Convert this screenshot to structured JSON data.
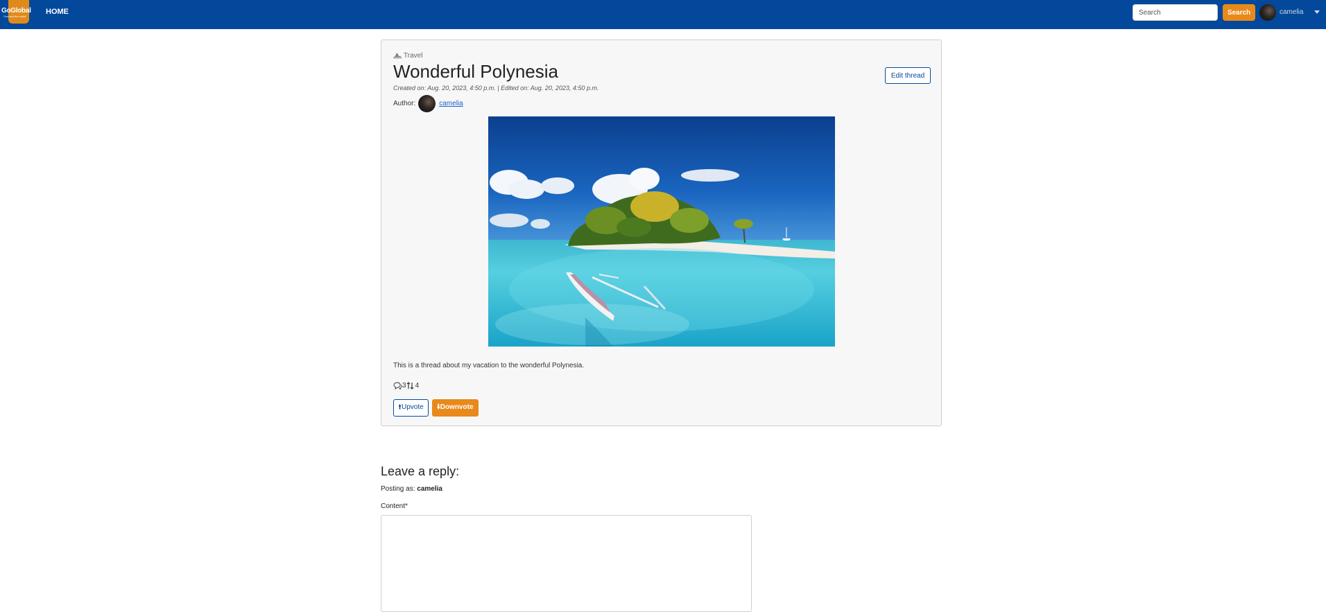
{
  "navbar": {
    "logo_text": "GoGlobal",
    "logo_subtext": "Connect the world",
    "home_label": "HOME",
    "search_placeholder": "Search",
    "search_button": "Search",
    "username": "camelia",
    "brand_color": "#03489a",
    "accent_color": "#e8891a"
  },
  "thread": {
    "category": "Travel",
    "category_icon": "plane-icon",
    "title": "Wonderful Polynesia",
    "meta": "Created on: Aug. 20, 2023, 4:50 p.m. | Edited on: Aug. 20, 2023, 4:50 p.m.",
    "author_label": "Author:",
    "author_name": "camelia",
    "edit_button": "Edit thread",
    "body": "This is a thread about my vacation to the wonderful Polynesia.",
    "comment_count": "3",
    "vote_count": "4",
    "upvote_label": "Upvote",
    "downvote_label": "Downvote"
  },
  "reply": {
    "heading": "Leave a reply:",
    "posting_as_label": "Posting as:",
    "posting_as_user": "camelia",
    "content_label": "Content*",
    "content_value": ""
  }
}
